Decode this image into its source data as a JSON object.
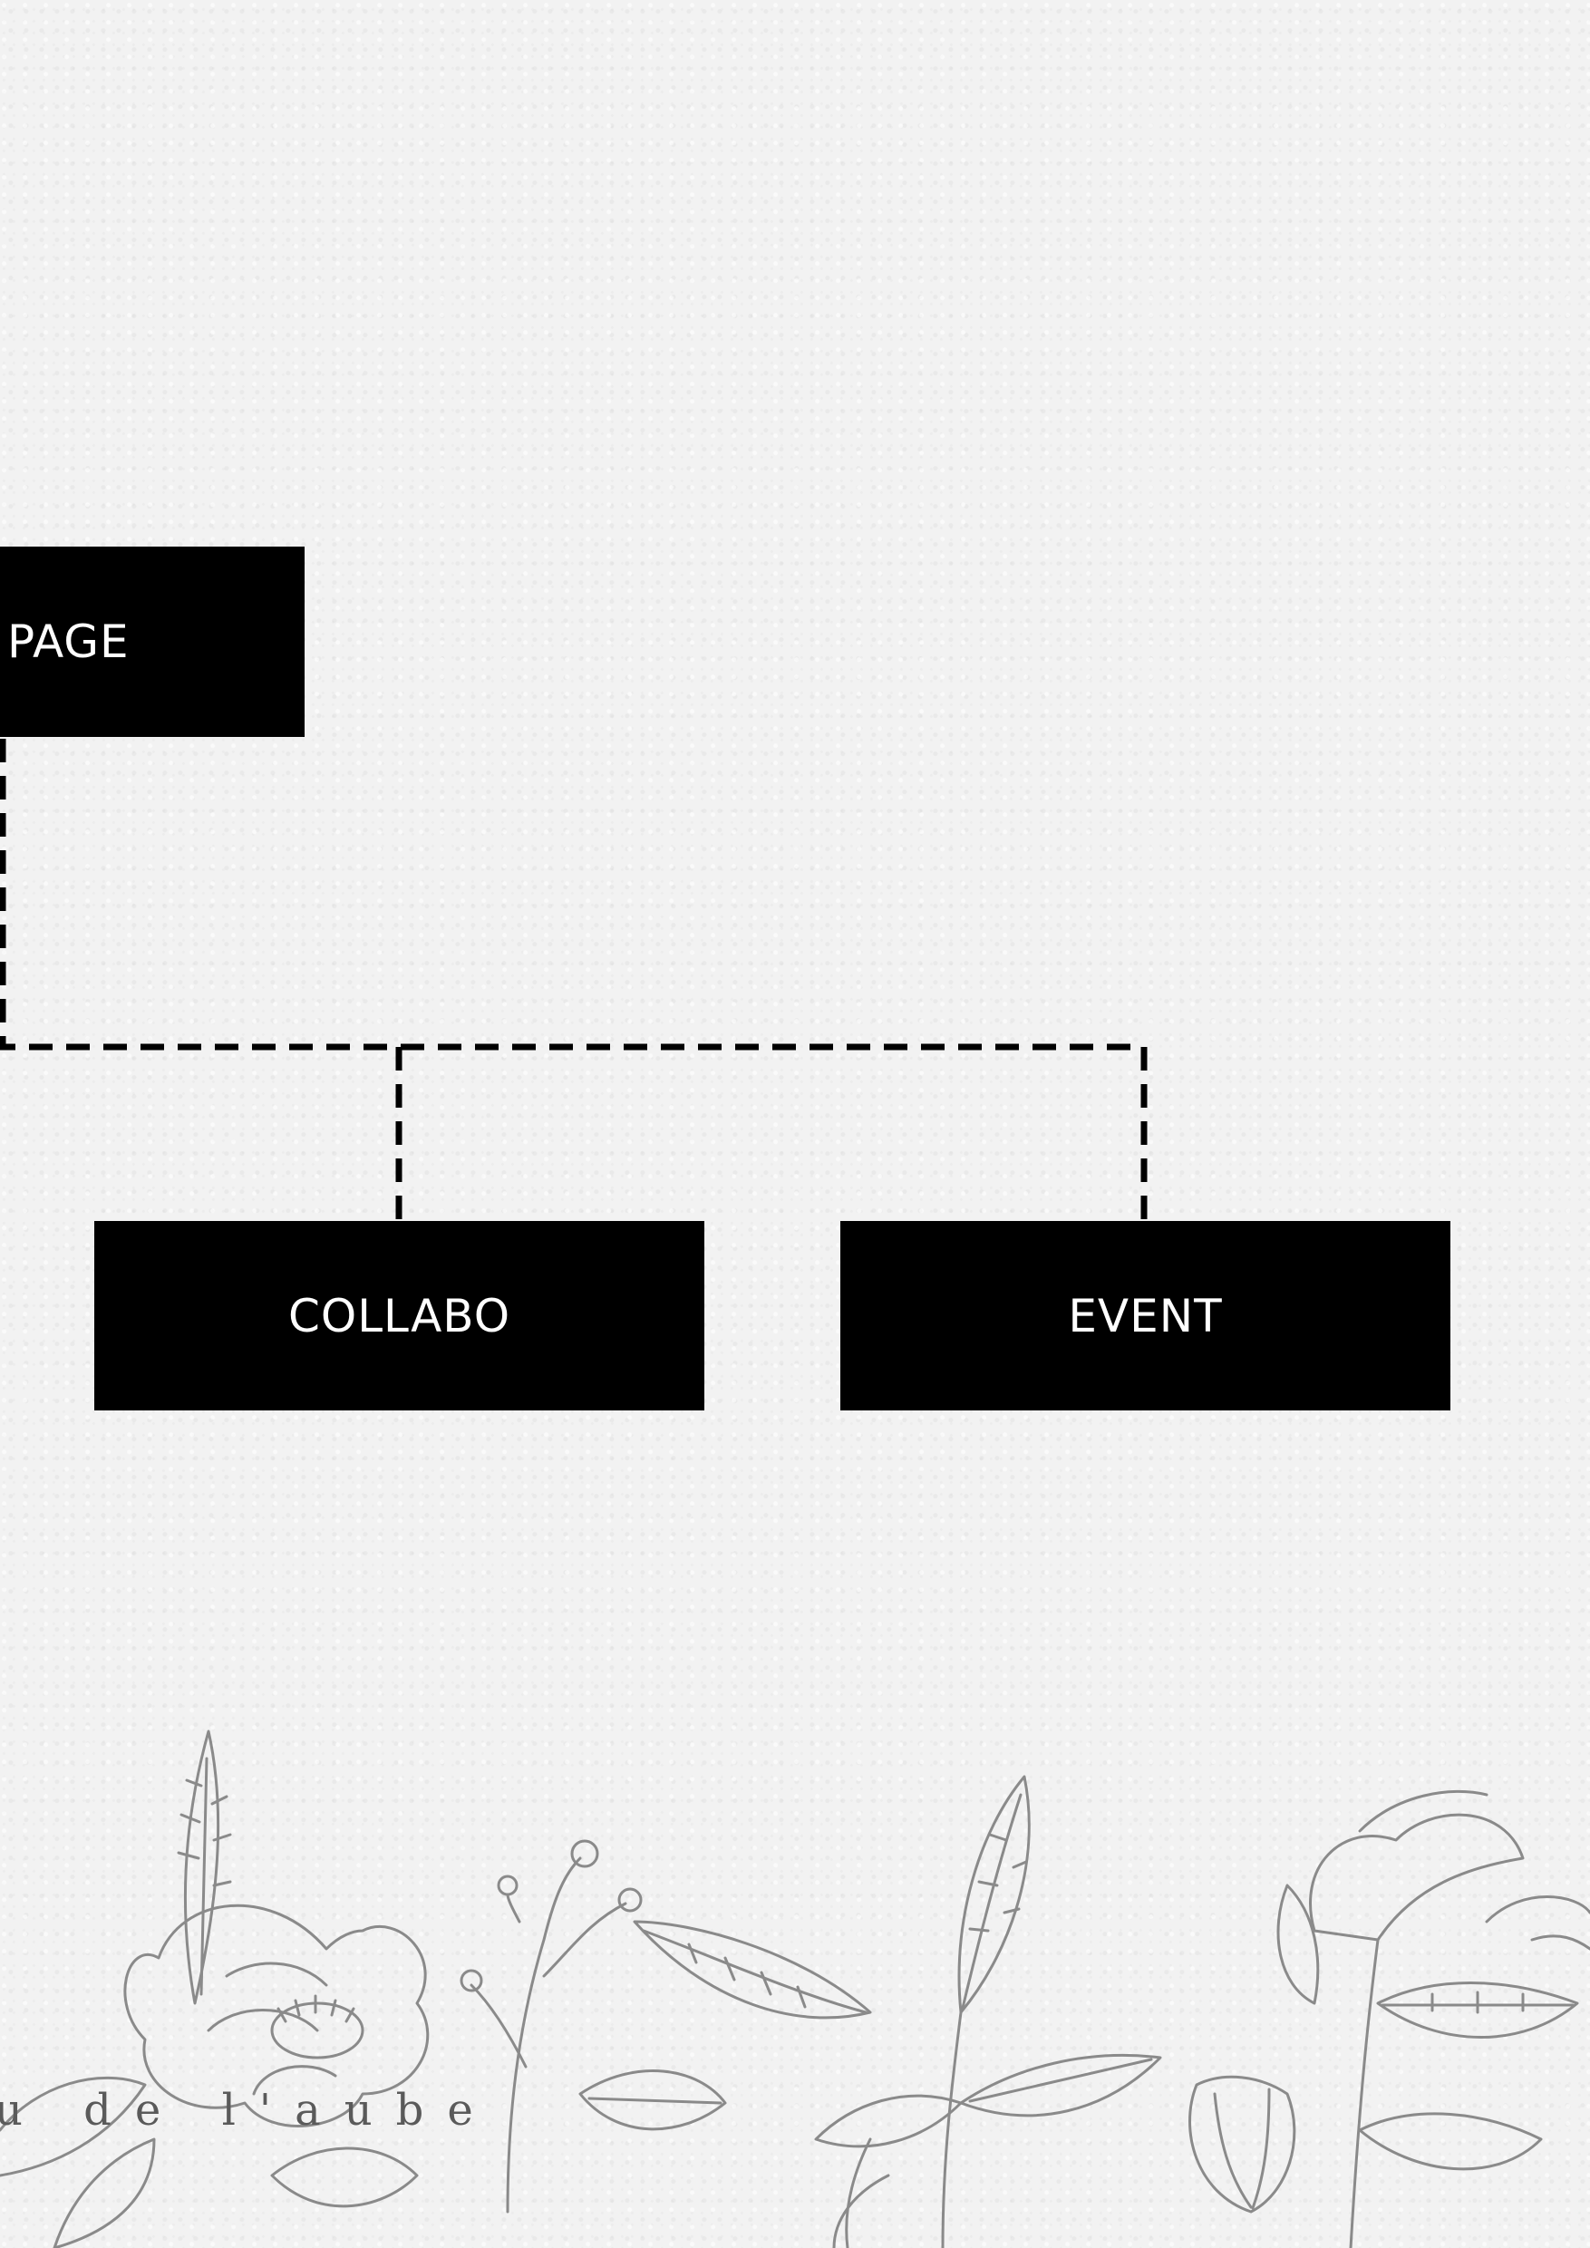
{
  "diagram": {
    "nodes": {
      "page": "PAGE",
      "collabo": "COLLABO",
      "event": "EVENT"
    },
    "edges": [
      {
        "from": "page",
        "to": "collabo",
        "style": "dashed"
      },
      {
        "from": "page",
        "to": "event",
        "style": "dashed"
      }
    ]
  },
  "footer": {
    "brand_text": "u de l'aube"
  },
  "colors": {
    "node_fill": "#000000",
    "node_text": "#ffffff",
    "connector": "#000000",
    "background": "#f2f2f2",
    "illustration": "#8a8a8a"
  },
  "icons": {
    "decoration": "botanical-illustration"
  }
}
